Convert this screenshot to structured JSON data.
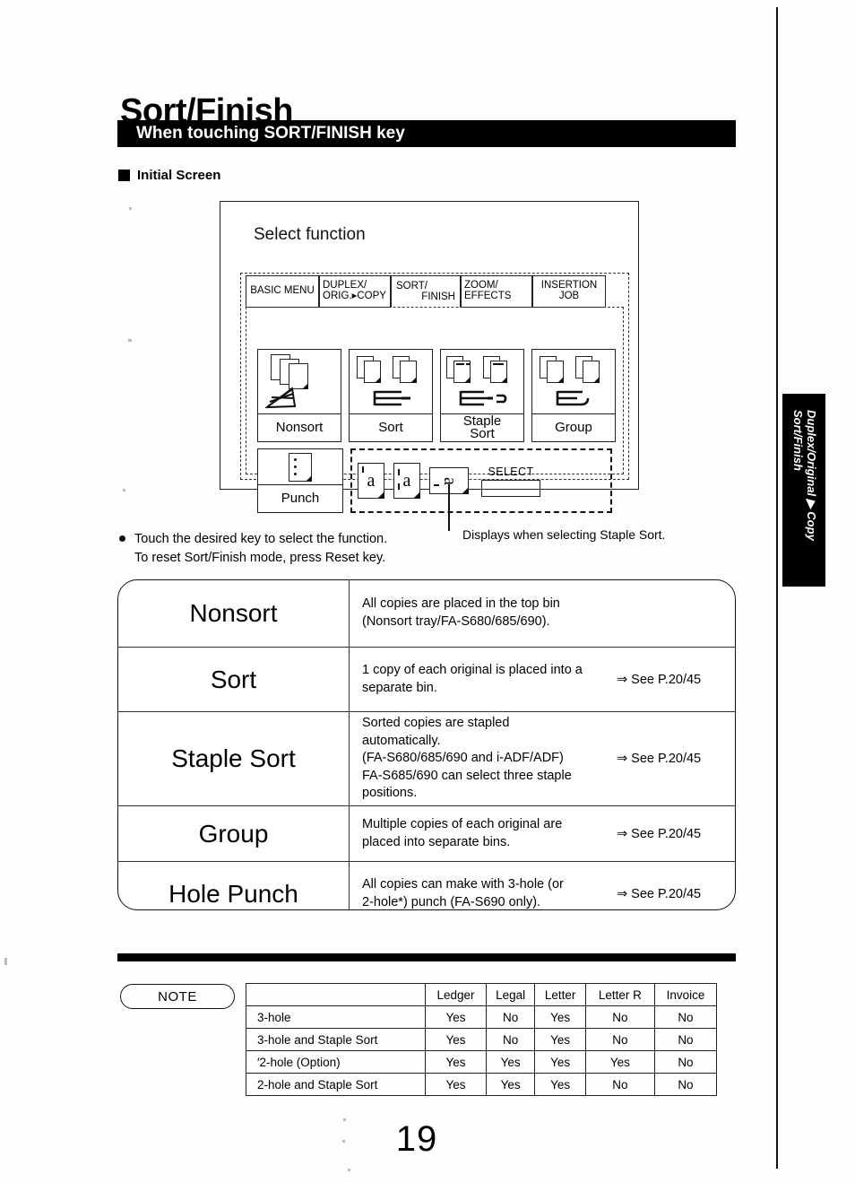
{
  "document": {
    "title": "Sort/Finish",
    "banner": "When touching SORT/FINISH key",
    "section_marker": "Initial Screen",
    "page_number": "19"
  },
  "side_tab": {
    "line1": "Duplex/Original ▶ Copy",
    "line2": "Sort/Finish"
  },
  "lcd": {
    "heading": "Select function",
    "tabs": [
      {
        "line1": "BASIC MENU",
        "line2": ""
      },
      {
        "line1": "DUPLEX/",
        "line2": "ORIG.▸COPY"
      },
      {
        "line1": "SORT/",
        "line2": "FINISH"
      },
      {
        "line1": "ZOOM/",
        "line2": "EFFECTS"
      },
      {
        "line1": "INSERTION",
        "line2": "JOB"
      }
    ],
    "active_tab": "SORT/FINISH",
    "buttons": [
      {
        "label": "Nonsort",
        "icon": "nonsort-stack-icon"
      },
      {
        "label": "Sort",
        "icon": "sort-bins-icon"
      },
      {
        "label_line1": "Staple",
        "label_line2": "Sort",
        "icon": "staple-sort-icon"
      },
      {
        "label": "Group",
        "icon": "group-bins-icon"
      },
      {
        "label": "Punch",
        "icon": "punch-holes-icon"
      }
    ],
    "staple_positions": [
      {
        "name": "staple-top-left-icon",
        "glyph": "a"
      },
      {
        "name": "staple-left-double-icon",
        "glyph": "a"
      },
      {
        "name": "staple-landscape-top-icon",
        "glyph": "a"
      }
    ],
    "select": {
      "label": "SELECT",
      "value": ""
    }
  },
  "callout": "Displays when selecting Staple Sort.",
  "instructions": {
    "line1": "Touch the desired key to select the function.",
    "line2": "To reset Sort/Finish mode, press Reset key."
  },
  "descriptions": [
    {
      "name": "Nonsort",
      "desc_line1": "All copies are placed in the top bin",
      "desc_line2": "(Nonsort tray/FA-S680/685/690).",
      "desc_line3": "",
      "desc_line4": "",
      "desc_line5": "",
      "ref": ""
    },
    {
      "name": "Sort",
      "desc_line1": "1 copy of each original is placed into a",
      "desc_line2": "separate bin.",
      "desc_line3": "",
      "desc_line4": "",
      "desc_line5": "",
      "ref": "⇒ See P.20/45"
    },
    {
      "name": "Staple Sort",
      "desc_line1": "Sorted copies are stapled",
      "desc_line2": "automatically.",
      "desc_line3": "(FA-S680/685/690 and i-ADF/ADF)",
      "desc_line4": "FA-S685/690 can select three staple",
      "desc_line5": "positions.",
      "ref": "⇒ See P.20/45"
    },
    {
      "name": "Group",
      "desc_line1": "Multiple copies of each original are",
      "desc_line2": "placed into separate bins.",
      "desc_line3": "",
      "desc_line4": "",
      "desc_line5": "",
      "ref": "⇒ See P.20/45"
    },
    {
      "name": "Hole Punch",
      "desc_line1": "All copies can make with 3-hole (or",
      "desc_line2": "2-hole*) punch (FA-S690 only).",
      "desc_line3": "",
      "desc_line4": "",
      "desc_line5": "",
      "ref": "⇒ See P.20/45"
    }
  ],
  "note": {
    "label": "NOTE",
    "columns": [
      "",
      "Ledger",
      "Legal",
      "Letter",
      "Letter R",
      "Invoice"
    ],
    "rows": [
      {
        "label": "3-hole",
        "cells": [
          "Yes",
          "No",
          "Yes",
          "No",
          "No"
        ]
      },
      {
        "label": "3-hole and Staple Sort",
        "cells": [
          "Yes",
          "No",
          "Yes",
          "No",
          "No"
        ]
      },
      {
        "label": "′2-hole (Option)",
        "cells": [
          "Yes",
          "Yes",
          "Yes",
          "Yes",
          "No"
        ]
      },
      {
        "label": "2-hole and Staple Sort",
        "cells": [
          "Yes",
          "Yes",
          "Yes",
          "No",
          "No"
        ]
      }
    ]
  }
}
